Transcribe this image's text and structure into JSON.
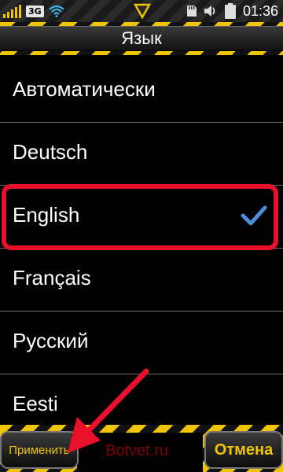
{
  "status_bar": {
    "network": "3G",
    "time": "01:36",
    "icons": [
      "signal-icon",
      "wifi-icon",
      "notification-icon",
      "sd-card-icon",
      "volume-icon",
      "battery-icon"
    ]
  },
  "header": {
    "title": "Язык"
  },
  "languages": [
    {
      "label": "Автоматически",
      "selected": false
    },
    {
      "label": "Deutsch",
      "selected": false
    },
    {
      "label": "English",
      "selected": true
    },
    {
      "label": "Français",
      "selected": false
    },
    {
      "label": "Русский",
      "selected": false
    },
    {
      "label": "Eesti",
      "selected": false
    }
  ],
  "softkeys": {
    "apply_label": "Применить",
    "cancel_label": "Отмена"
  },
  "watermark": "Botvet.ru",
  "colors": {
    "accent": "#f0c400",
    "highlight": "#e8102a",
    "check": "#4a90d9",
    "arrow": "#e8102a"
  }
}
